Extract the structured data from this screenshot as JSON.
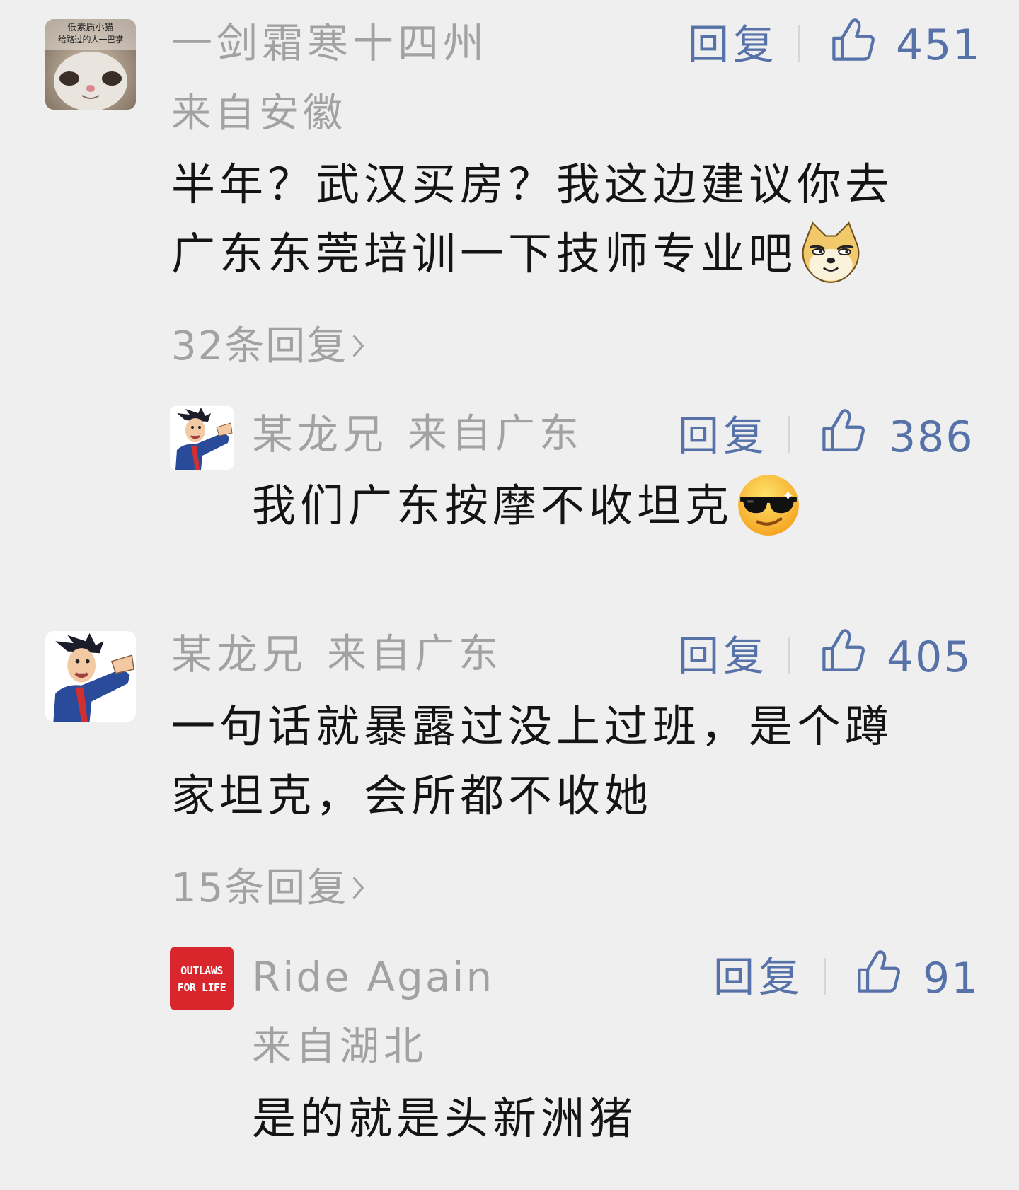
{
  "comments": [
    {
      "username": "一剑霜寒十四州",
      "location": "来自安徽",
      "reply_label": "回复",
      "likes": "451",
      "text_lines": [
        "半年？武汉买房？我这边建议你去",
        "广东东莞培训一下技师专业吧"
      ],
      "avatar_caption": [
        "低素质小猫",
        "给路过的人一巴掌"
      ],
      "more_replies": "32条回复",
      "sub_reply": {
        "username": "某龙兄",
        "location": "来自广东",
        "reply_label": "回复",
        "likes": "386",
        "text": "我们广东按摩不收坦克"
      }
    },
    {
      "username": "某龙兄",
      "location": "来自广东",
      "reply_label": "回复",
      "likes": "405",
      "text_lines": [
        "一句话就暴露过没上过班，是个蹲",
        "家坦克，会所都不收她"
      ],
      "more_replies": "15条回复",
      "sub_reply": {
        "username": "Ride Again",
        "location": "来自湖北",
        "reply_label": "回复",
        "likes": "91",
        "text": "是的就是头新洲猪",
        "avatar_logo": [
          "OUTLAWS",
          "FOR LIFE"
        ]
      }
    }
  ],
  "icons": {
    "like": "thumbs-up-icon",
    "chevron": "chevron-right-icon",
    "emoji_doge": "doge-emoji-icon",
    "emoji_cool": "sunglasses-emoji-icon"
  },
  "colors": {
    "background": "#efefef",
    "username": "#a2a2a2",
    "text": "#141414",
    "reply_link": "#5772a8",
    "logo_red": "#d8262c"
  }
}
